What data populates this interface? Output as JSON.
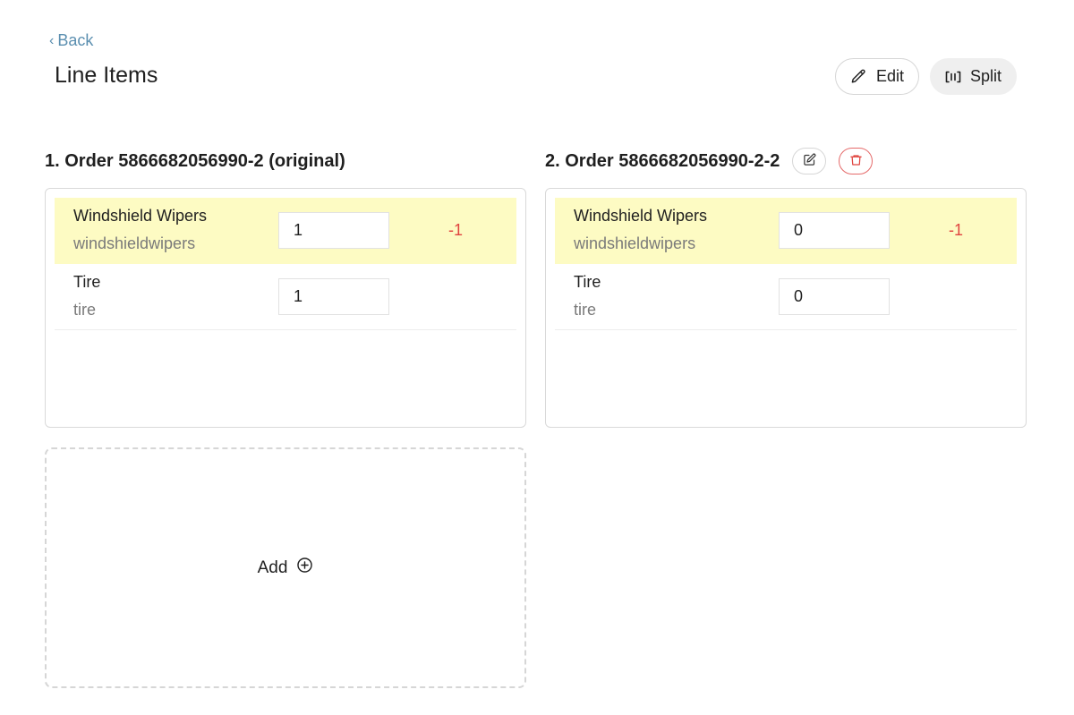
{
  "header": {
    "back_label": "Back",
    "title": "Line Items",
    "edit_label": "Edit",
    "split_label": "Split"
  },
  "orders": [
    {
      "title": "1. Order 5866682056990-2 (original)",
      "items": [
        {
          "name": "Windshield Wipers",
          "sku": "windshieldwipers",
          "quantity": "1",
          "diff": "-1",
          "highlighted": true
        },
        {
          "name": "Tire",
          "sku": "tire",
          "quantity": "1",
          "diff": "",
          "highlighted": false
        }
      ]
    },
    {
      "title": "2. Order 5866682056990-2-2",
      "items": [
        {
          "name": "Windshield Wipers",
          "sku": "windshieldwipers",
          "quantity": "0",
          "diff": "-1",
          "highlighted": true
        },
        {
          "name": "Tire",
          "sku": "tire",
          "quantity": "0",
          "diff": "",
          "highlighted": false
        }
      ]
    }
  ],
  "add_card": {
    "label": "Add"
  },
  "icons": {
    "back": "chevron-left-icon",
    "edit": "pencil-icon",
    "split": "split-icon",
    "order_edit": "edit-square-icon",
    "order_delete": "trash-icon",
    "add": "plus-circle-icon"
  },
  "colors": {
    "link": "#5b8fb0",
    "highlight_row": "#fdfbc3",
    "diff_negative": "#e0443f",
    "danger_border": "#e56a6a"
  }
}
